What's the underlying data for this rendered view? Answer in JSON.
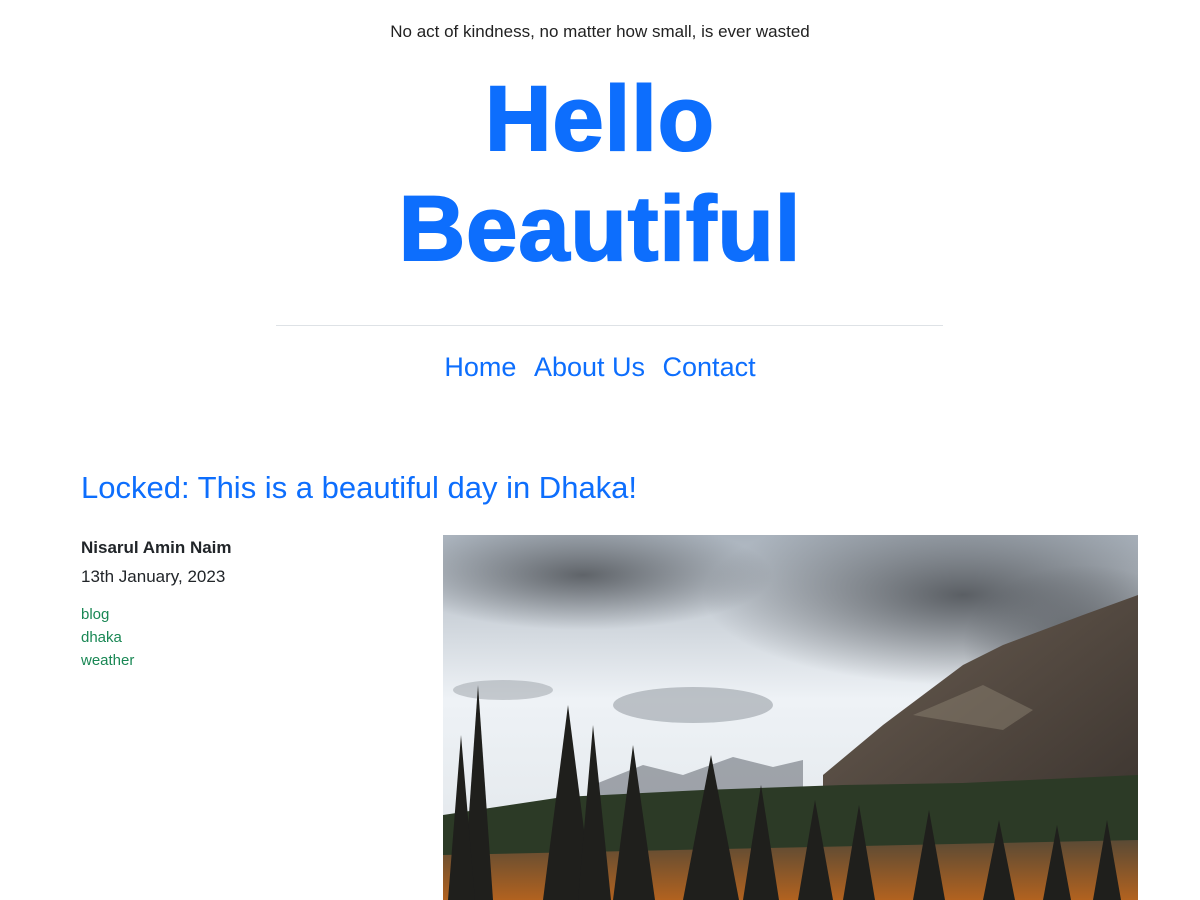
{
  "header": {
    "tagline": "No act of kindness, no matter how small, is ever wasted",
    "title_line1": "Hello",
    "title_line2": "Beautiful"
  },
  "nav": {
    "items": [
      {
        "label": "Home"
      },
      {
        "label": "About Us"
      },
      {
        "label": "Contact"
      }
    ]
  },
  "post": {
    "title": "Locked: This is a beautiful day in Dhaka!",
    "author": "Nisarul Amin Naim",
    "date": "13th January, 2023",
    "tags": [
      "blog",
      "dhaka",
      "weather"
    ],
    "image_subject": "mountain-forest-landscape"
  },
  "colors": {
    "primary": "#0d6efd",
    "tag": "#198754",
    "text": "#212529"
  }
}
